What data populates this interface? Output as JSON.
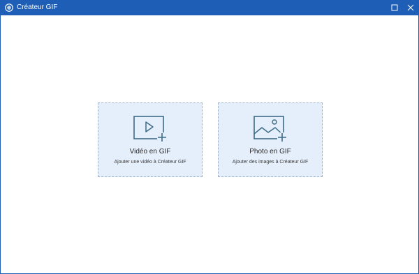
{
  "window": {
    "title": "Créateur GIF",
    "icon": "app-icon",
    "controls": [
      "maximize-icon",
      "close-icon"
    ]
  },
  "colors": {
    "titlebar": "#1e5eb6",
    "card_background": "#e5eefb",
    "card_border": "#9fb0c8",
    "icon_stroke": "#3d6b86"
  },
  "cards": [
    {
      "title": "Vidéo en GIF",
      "subtitle": "Ajouter une vidéo à Créateur GIF",
      "icon": "video-add-icon"
    },
    {
      "title": "Photo en GIF",
      "subtitle": "Ajouter des images à Créateur GIF",
      "icon": "image-add-icon"
    }
  ]
}
